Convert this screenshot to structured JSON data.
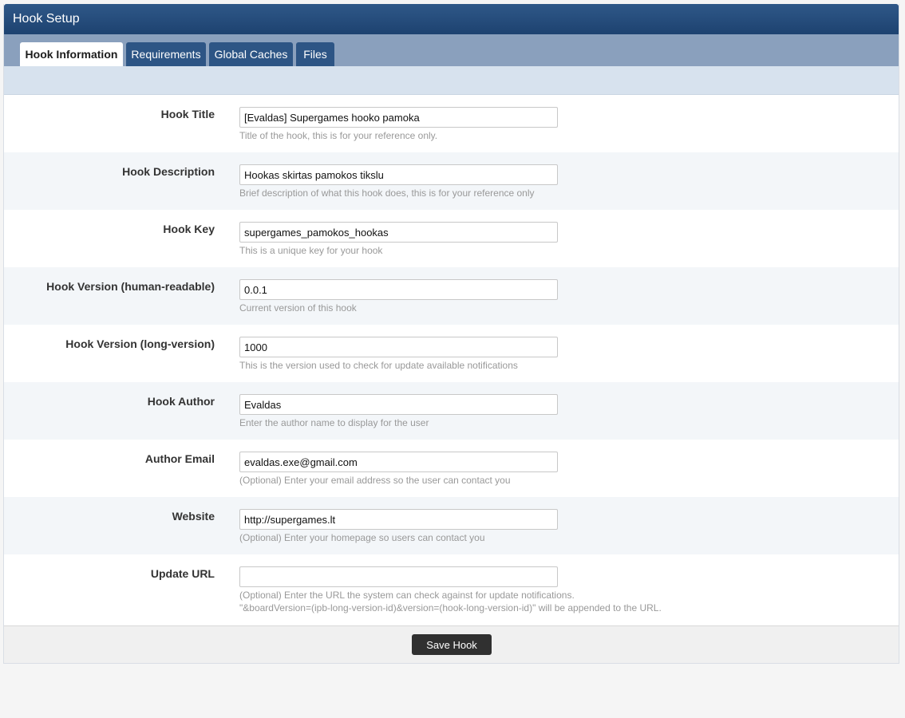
{
  "window": {
    "title": "Hook Setup"
  },
  "tabs": [
    {
      "label": "Hook Information",
      "active": true
    },
    {
      "label": "Requirements",
      "active": false
    },
    {
      "label": "Global Caches",
      "active": false
    },
    {
      "label": "Files",
      "active": false
    }
  ],
  "form": {
    "fields": [
      {
        "label": "Hook Title",
        "value": "[Evaldas] Supergames hooko pamoka",
        "help": "Title of the hook, this is for your reference only."
      },
      {
        "label": "Hook Description",
        "value": "Hookas skirtas pamokos tikslu",
        "help": "Brief description of what this hook does, this is for your reference only"
      },
      {
        "label": "Hook Key",
        "value": "supergames_pamokos_hookas",
        "help": "This is a unique key for your hook"
      },
      {
        "label": "Hook Version (human-readable)",
        "value": "0.0.1",
        "help": "Current version of this hook"
      },
      {
        "label": "Hook Version (long-version)",
        "value": "1000",
        "help": "This is the version used to check for update available notifications"
      },
      {
        "label": "Hook Author",
        "value": "Evaldas",
        "help": "Enter the author name to display for the user"
      },
      {
        "label": "Author Email",
        "value": "evaldas.exe@gmail.com",
        "help": "(Optional) Enter your email address so the user can contact you"
      },
      {
        "label": "Website",
        "value": "http://supergames.lt",
        "help": "(Optional) Enter your homepage so users can contact you"
      },
      {
        "label": "Update URL",
        "value": "",
        "help": "(Optional) Enter the URL the system can check against for update notifications.",
        "help2": "\"&boardVersion=(ipb-long-version-id)&version=(hook-long-version-id)\" will be appended to the URL."
      }
    ]
  },
  "footer": {
    "save_label": "Save Hook"
  },
  "colors": {
    "titlebar": "#2f5888",
    "tabbar": "#8aa0bd",
    "tab_inactive": "#2d5585",
    "subbar": "#d7e2ee",
    "row_alt": "#f3f6f9",
    "save_button": "#303030"
  }
}
